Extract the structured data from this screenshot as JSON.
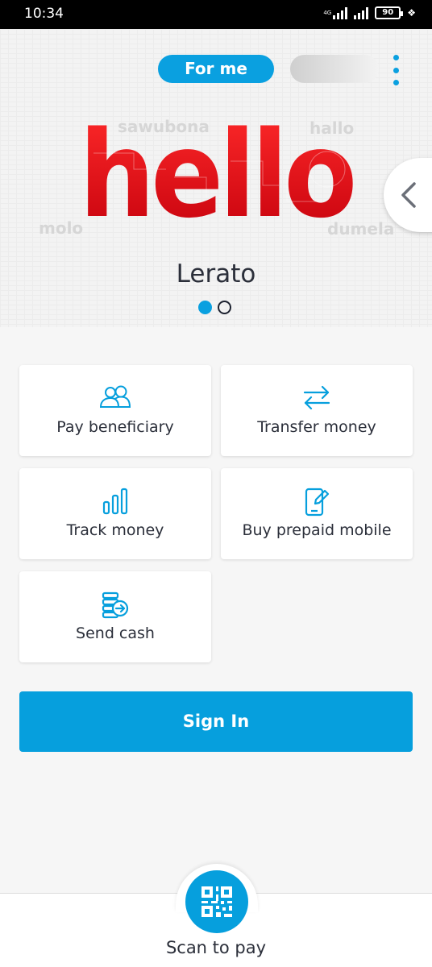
{
  "status_bar": {
    "time": "10:34",
    "network_tag": "4G",
    "battery": "90"
  },
  "header": {
    "profile_toggle_active": "For me"
  },
  "hero": {
    "greetings": [
      "sawubona",
      "hallo",
      "molo",
      "dumela"
    ],
    "big_word": "hello",
    "user_name": "Lerato",
    "page_count": 2,
    "active_page": 0
  },
  "tiles": [
    {
      "label": "Pay beneficiary",
      "icon": "people-icon"
    },
    {
      "label": "Transfer money",
      "icon": "transfer-arrows-icon"
    },
    {
      "label": "Track money",
      "icon": "bar-chart-icon"
    },
    {
      "label": "Buy prepaid mobile",
      "icon": "mobile-edit-icon"
    },
    {
      "label": "Send cash",
      "icon": "send-cash-icon"
    }
  ],
  "sign_in": {
    "label": "Sign In"
  },
  "bottom_nav": {
    "scan_label": "Scan to pay",
    "icon": "qr-code-icon"
  },
  "colors": {
    "accent": "#069fdd",
    "hello_red": "#e30613",
    "text": "#2b2f3a"
  }
}
